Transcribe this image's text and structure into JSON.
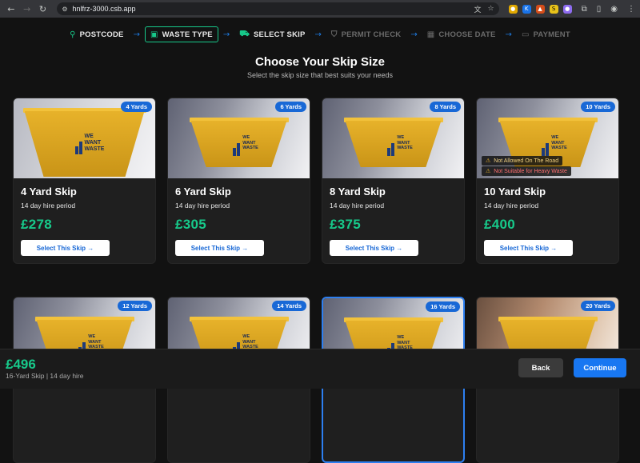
{
  "browser": {
    "url": "hnlfrz-3000.csb.app"
  },
  "steps": [
    {
      "label": "POSTCODE",
      "icon": "map-pin-icon",
      "state": "done"
    },
    {
      "label": "WASTE TYPE",
      "icon": "trash-icon",
      "state": "done"
    },
    {
      "label": "SELECT SKIP",
      "icon": "truck-icon",
      "state": "done"
    },
    {
      "label": "PERMIT CHECK",
      "icon": "shield-icon",
      "state": "todo"
    },
    {
      "label": "CHOOSE DATE",
      "icon": "calendar-icon",
      "state": "todo"
    },
    {
      "label": "PAYMENT",
      "icon": "credit-card-icon",
      "state": "todo"
    }
  ],
  "heading": {
    "title": "Choose Your Skip Size",
    "subtitle": "Select the skip size that best suits your needs"
  },
  "skips": [
    {
      "badge": "4 Yards",
      "name": "4 Yard Skip",
      "period": "14 day hire period",
      "price": "£278",
      "button": "Select This Skip →"
    },
    {
      "badge": "6 Yards",
      "name": "6 Yard Skip",
      "period": "14 day hire period",
      "price": "£305",
      "button": "Select This Skip →"
    },
    {
      "badge": "8 Yards",
      "name": "8 Yard Skip",
      "period": "14 day hire period",
      "price": "£375",
      "button": "Select This Skip →"
    },
    {
      "badge": "10 Yards",
      "name": "10 Yard Skip",
      "period": "14 day hire period",
      "price": "£400",
      "button": "Select This Skip →",
      "warning_road": "Not Allowed On The Road",
      "warning_heavy": "Not Suitable for Heavy Waste"
    },
    {
      "badge": "12 Yards"
    },
    {
      "badge": "14 Yards"
    },
    {
      "badge": "16 Yards",
      "selected": true
    },
    {
      "badge": "20 Yards"
    }
  ],
  "skip_logo": [
    "WE",
    "WANT",
    "WASTE"
  ],
  "footer": {
    "total": "£496",
    "summary": "16-Yard Skip | 14 day hire",
    "back": "Back",
    "continue": "Continue"
  },
  "colors": {
    "accent_green": "#17c98a",
    "accent_blue": "#1877f2",
    "background": "#121212"
  }
}
